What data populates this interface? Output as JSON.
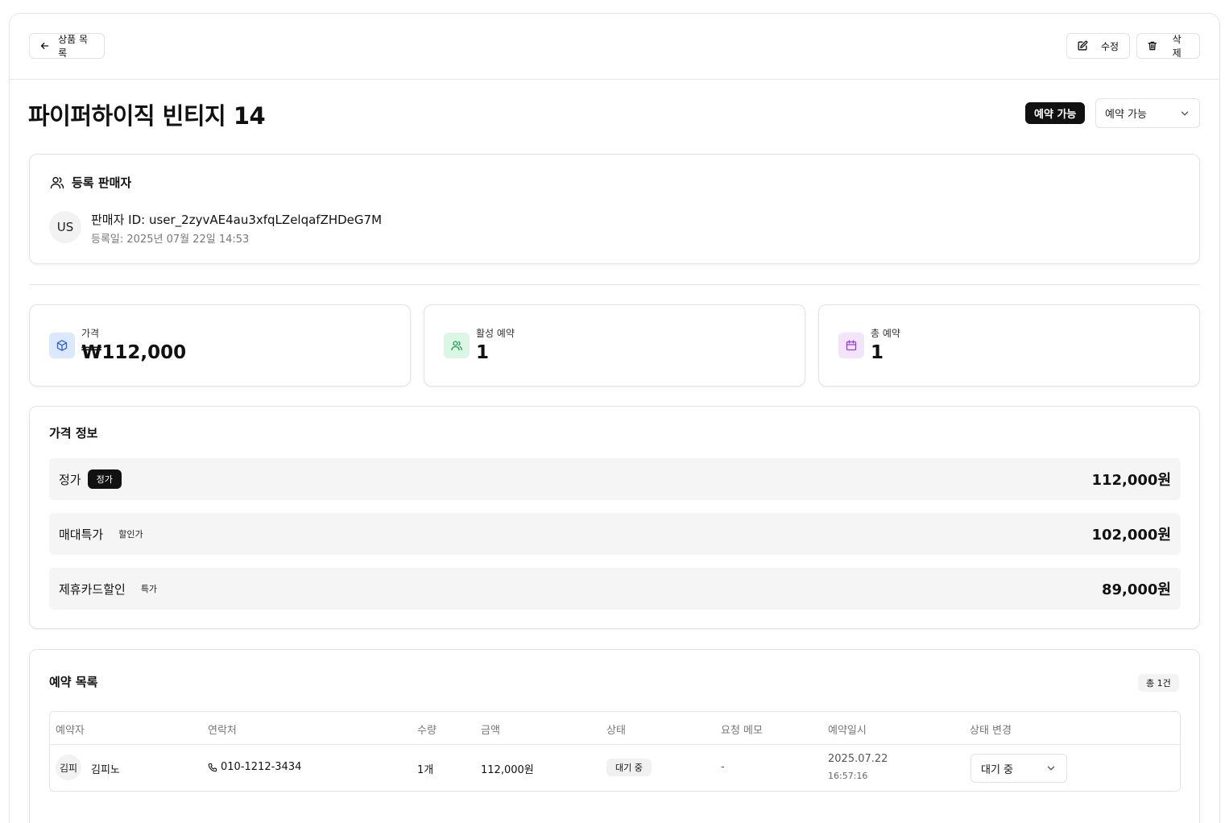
{
  "header": {
    "back_label": "상품 목록",
    "edit_label": "수정",
    "delete_label": "삭제"
  },
  "product": {
    "title": "파이퍼하이직 빈티지 14",
    "status_badge": "예약 가능",
    "status_select": "예약 가능"
  },
  "seller": {
    "heading": "등록 판매자",
    "avatar": "US",
    "id_text": "판매자 ID: user_2zyvAE4au3xfqLZelqafZHDeG7M",
    "date_text": "등록일: 2025년 07월 22일 14:53"
  },
  "stats": [
    {
      "label": "가격",
      "value": "₩112,000",
      "icon": "box-icon",
      "color": "#dbe8ff"
    },
    {
      "label": "활성 예약",
      "value": "1",
      "icon": "users-icon",
      "color": "#dcf6e6"
    },
    {
      "label": "총 예약",
      "value": "1",
      "icon": "calendar-icon",
      "color": "#f1e4fb"
    }
  ],
  "pricing": {
    "title": "가격 정보",
    "rows": [
      {
        "label": "정가",
        "tag": "정가",
        "value": "112,000원"
      },
      {
        "label": "매대특가",
        "tag": "할인가",
        "value": "102,000원"
      },
      {
        "label": "제휴카드할인",
        "tag": "특가",
        "value": "89,000원"
      }
    ]
  },
  "reservations": {
    "title": "예약 목록",
    "count": "총 1건",
    "columns": [
      "예약자",
      "연락처",
      "수량",
      "금액",
      "상태",
      "요청 메모",
      "예약일시",
      "상태 변경"
    ],
    "rows": [
      {
        "avatar": "김피",
        "name": "김피노",
        "phone": "010-1212-3434",
        "qty": "1개",
        "amount": "112,000원",
        "status": "대기 중",
        "memo": "-",
        "date": "2025.07.22",
        "time": "16:57:16",
        "change": "대기 중"
      }
    ]
  }
}
